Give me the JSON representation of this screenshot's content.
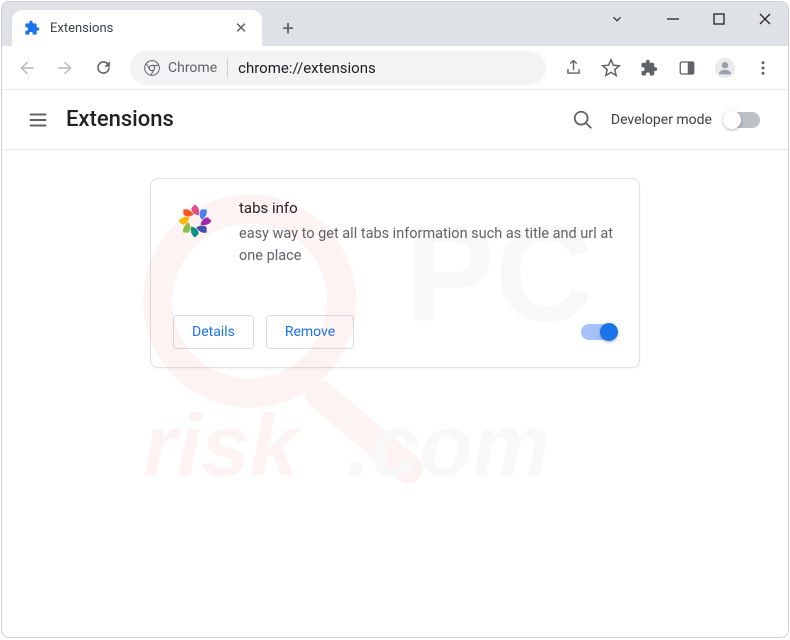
{
  "tab": {
    "title": "Extensions"
  },
  "omnibox": {
    "chip": "Chrome",
    "url": "chrome://extensions"
  },
  "page": {
    "title": "Extensions",
    "devmode_label": "Developer mode"
  },
  "extension": {
    "name": "tabs info",
    "description": "easy way to get all tabs information such as title and url at one place",
    "details_label": "Details",
    "remove_label": "Remove"
  }
}
